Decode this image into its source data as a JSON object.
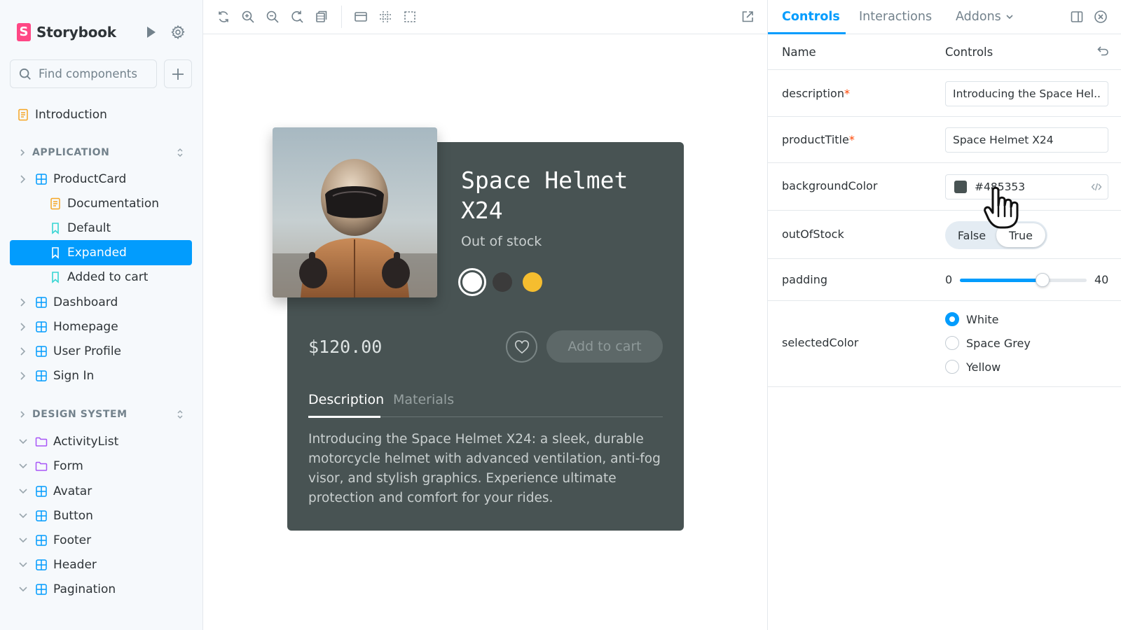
{
  "sidebar": {
    "brand": "Storybook",
    "search": {
      "placeholder": "Find components",
      "value": ""
    },
    "intro": "Introduction",
    "sections": [
      {
        "title": "APPLICATION"
      },
      {
        "title": "DESIGN SYSTEM"
      }
    ],
    "application_items": [
      {
        "label": "ProductCard",
        "icon": "component-icon",
        "expanded": true
      },
      {
        "label": "Documentation",
        "icon": "document-icon"
      },
      {
        "label": "Default",
        "icon": "bookmark-icon"
      },
      {
        "label": "Expanded",
        "icon": "bookmark-icon",
        "selected": true
      },
      {
        "label": "Added to cart",
        "icon": "bookmark-icon"
      },
      {
        "label": "Dashboard",
        "icon": "component-icon"
      },
      {
        "label": "Homepage",
        "icon": "component-icon"
      },
      {
        "label": "User Profile",
        "icon": "component-icon"
      },
      {
        "label": "Sign In",
        "icon": "component-icon"
      }
    ],
    "design_items": [
      {
        "label": "ActivityList",
        "icon": "folder-icon"
      },
      {
        "label": "Form",
        "icon": "folder-icon"
      },
      {
        "label": "Avatar",
        "icon": "component-icon"
      },
      {
        "label": "Button",
        "icon": "component-icon"
      },
      {
        "label": "Footer",
        "icon": "component-icon"
      },
      {
        "label": "Header",
        "icon": "component-icon"
      },
      {
        "label": "Pagination",
        "icon": "component-icon"
      }
    ]
  },
  "toolbar": {
    "tools": [
      "reload-icon",
      "zoom-in-icon",
      "zoom-out-icon",
      "zoom-reset-icon",
      "background-icon",
      "viewport-icon",
      "grid-icon",
      "outline-icon"
    ],
    "open_new_tab": "external-link-icon"
  },
  "product_card": {
    "title": "Space Helmet X24",
    "stock": "Out of stock",
    "price": "$120.00",
    "add_to_cart": "Add to cart",
    "swatches": [
      {
        "name": "White",
        "color": "#ffffff",
        "selected": true
      },
      {
        "name": "Space Grey",
        "color": "#3b3b3b"
      },
      {
        "name": "Yellow",
        "color": "#f5bd2f"
      }
    ],
    "tabs": [
      "Description",
      "Materials"
    ],
    "active_tab": "Description",
    "description": "Introducing the Space Helmet X24: a sleek, durable motorcycle helmet with advanced ventilation, anti-fog visor, and stylish graphics. Experience ultimate protection and comfort for your rides.",
    "background": "#485353"
  },
  "panel": {
    "tabs": [
      "Controls",
      "Interactions",
      "Addons"
    ],
    "active_tab": "Controls",
    "header": {
      "name": "Name",
      "controls": "Controls"
    },
    "controls": {
      "description": {
        "label": "description",
        "required": "*",
        "value": "Introducing the Space Hel..."
      },
      "productTitle": {
        "label": "productTitle",
        "required": "*",
        "value": "Space Helmet X24"
      },
      "backgroundColor": {
        "label": "backgroundColor",
        "value": "#485353"
      },
      "outOfStock": {
        "label": "outOfStock",
        "false_label": "False",
        "true_label": "True",
        "value": true
      },
      "padding": {
        "label": "padding",
        "min": "0",
        "max": "40",
        "value": 26
      },
      "selectedColor": {
        "label": "selectedColor",
        "options": [
          "White",
          "Space Grey",
          "Yellow"
        ],
        "value": "White"
      }
    }
  },
  "colors": {
    "accent": "#029cfd",
    "brand": "#ff4785",
    "card_bg": "#485353"
  }
}
